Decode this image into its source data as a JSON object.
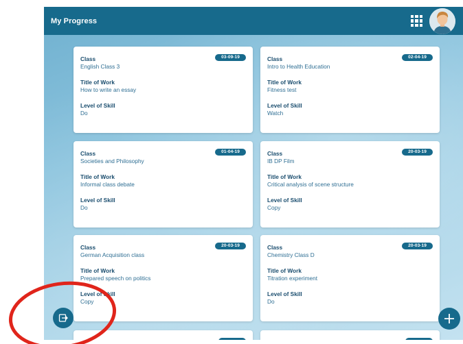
{
  "header": {
    "title": "My Progress",
    "grid_icon": "apps-grid-icon",
    "avatar_icon": "user-avatar-icon"
  },
  "labels": {
    "class": "Class",
    "title_of_work": "Title of Work",
    "level_of_skill": "Level of Skill"
  },
  "cards": [
    {
      "date": "03-09-19",
      "class": "English Class 3",
      "title": "How to write an essay",
      "level": "Do"
    },
    {
      "date": "02-04-19",
      "class": "Intro to Health Education",
      "title": "Fitness test",
      "level": "Watch"
    },
    {
      "date": "01-04-19",
      "class": "Societies and Philosophy",
      "title": "Informal class debate",
      "level": "Do"
    },
    {
      "date": "20-03-19",
      "class": "IB DP Film",
      "title": "Critical analysis of scene structure",
      "level": "Copy"
    },
    {
      "date": "20-03-19",
      "class": "German Acquisition class",
      "title": "Prepared speech on politics",
      "level": "Copy"
    },
    {
      "date": "20-03-19",
      "class": "Chemistry Class D",
      "title": "Titration experiment",
      "level": "Do"
    }
  ],
  "buttons": {
    "exit_icon": "exit-icon",
    "add_icon": "plus-icon"
  },
  "colors": {
    "header": "#176a8c",
    "badge": "#176a8c",
    "annotation": "#e0251b"
  }
}
